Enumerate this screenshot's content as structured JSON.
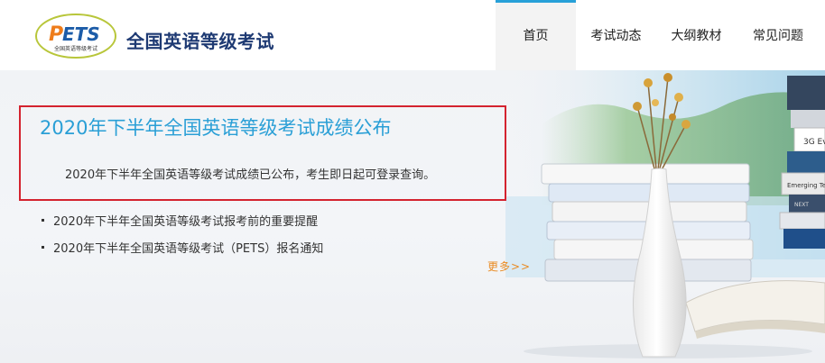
{
  "header": {
    "logo_text": "PETS",
    "logo_subtext": "全国英语等级考试",
    "site_title": "全国英语等级考试"
  },
  "nav": {
    "items": [
      {
        "label": "首页",
        "active": true
      },
      {
        "label": "考试动态",
        "active": false
      },
      {
        "label": "大纲教材",
        "active": false
      },
      {
        "label": "常见问题",
        "active": false
      }
    ]
  },
  "banner": {
    "headline": "2020年下半年全国英语等级考试成绩公布",
    "summary": "2020年下半年全国英语等级考试成绩已公布，考生即日起可登录查询。",
    "news": [
      "2020年下半年全国英语等级考试报考前的重要提醒",
      "2020年下半年全国英语等级考试（PETS）报名通知"
    ],
    "more_label": "更多>>",
    "book_spines": [
      "3G Ev",
      "Emerging Te",
      "NEXT"
    ]
  },
  "colors": {
    "accent": "#27a0d8",
    "title": "#1e3a73",
    "highlight_border": "#d4232f",
    "more_link": "#e98b23"
  }
}
